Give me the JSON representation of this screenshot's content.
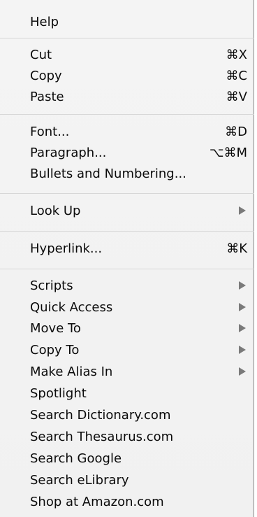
{
  "menu": {
    "help": "Help",
    "cut": {
      "label": "Cut",
      "shortcut": "⌘X"
    },
    "copy": {
      "label": "Copy",
      "shortcut": "⌘C"
    },
    "paste": {
      "label": "Paste",
      "shortcut": "⌘V"
    },
    "font": {
      "label": "Font...",
      "shortcut": "⌘D"
    },
    "paragraph": {
      "label": "Paragraph...",
      "shortcut": "⌥⌘M"
    },
    "bullets": {
      "label": "Bullets and Numbering..."
    },
    "look_up": {
      "label": "Look Up",
      "icon": "submenu-arrow-icon"
    },
    "hyperlink": {
      "label": "Hyperlink...",
      "shortcut": "⌘K"
    },
    "scripts": {
      "label": "Scripts",
      "icon": "submenu-arrow-icon"
    },
    "quick_access": {
      "label": "Quick Access",
      "icon": "submenu-arrow-icon"
    },
    "move_to": {
      "label": "Move To",
      "icon": "submenu-arrow-icon"
    },
    "copy_to": {
      "label": "Copy To",
      "icon": "submenu-arrow-icon"
    },
    "make_alias_in": {
      "label": "Make Alias In",
      "icon": "submenu-arrow-icon"
    },
    "spotlight": {
      "label": "Spotlight"
    },
    "search_dictionary": {
      "label": "Search Dictionary.com"
    },
    "search_thesaurus": {
      "label": "Search Thesaurus.com"
    },
    "search_google": {
      "label": "Search Google"
    },
    "search_elibrary": {
      "label": "Search eLibrary"
    },
    "shop_amazon": {
      "label": "Shop at Amazon.com"
    }
  },
  "colors": {
    "menu_background": "#f2f2f2",
    "text": "#0b0b0b",
    "separator": "#d6d6d6",
    "arrow": "#7a7a7a"
  }
}
